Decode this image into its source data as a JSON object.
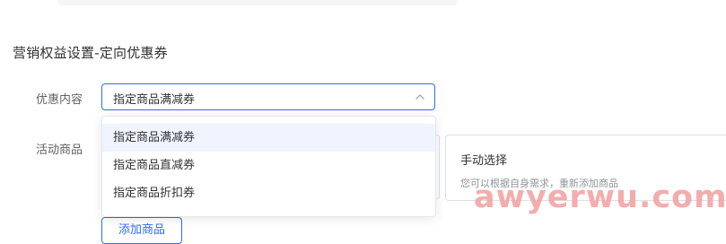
{
  "page": {
    "section_title": "营销权益设置-定向优惠券"
  },
  "form": {
    "coupon_label": "优惠内容",
    "goods_label": "活动商品",
    "coupon_select": {
      "value": "指定商品满减券",
      "state": "expanded",
      "options": [
        {
          "label": "指定商品满减券",
          "selected": true
        },
        {
          "label": "指定商品直减券",
          "selected": false
        },
        {
          "label": "指定商品折扣券",
          "selected": false
        }
      ]
    },
    "manual_choice": {
      "title": "手动选择",
      "description": "您可以根据自身需求，重新添加商品"
    },
    "add_goods_label": "添加商品"
  },
  "watermark": "awyerwu.com",
  "icons": {
    "select_arrow": "chevron-up-icon"
  },
  "colors": {
    "accent": "#2f6bff",
    "selected_option_bg": "#f0f4ff",
    "watermark": "#f3a5a5"
  }
}
